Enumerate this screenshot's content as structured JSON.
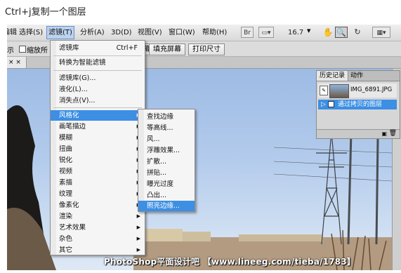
{
  "caption": "Ctrl+j复制一个图层",
  "menubar": {
    "items": [
      "编辑",
      "选择(S)",
      "滤镜(T)",
      "分析(A)",
      "3D(D)",
      "视图(V)",
      "窗口(W)",
      "帮助(H)"
    ],
    "zoom": "16.7"
  },
  "options": {
    "left_text": "示",
    "checkbox_label": "缩放所",
    "buttons": [
      "屏幕",
      "填充屏幕",
      "打印尺寸"
    ]
  },
  "doc_tab": {
    "label": "× ×"
  },
  "filter_menu": {
    "items": [
      {
        "label": "滤镜库",
        "shortcut": "Ctrl+F"
      },
      {
        "label": "转换为智能滤镜"
      },
      {
        "label": "滤镜库(G)..."
      },
      {
        "label": "液化(L)..."
      },
      {
        "label": "消失点(V)..."
      },
      {
        "label": "风格化"
      },
      {
        "label": "画笔描边"
      },
      {
        "label": "模糊"
      },
      {
        "label": "扭曲"
      },
      {
        "label": "锐化"
      },
      {
        "label": "视频"
      },
      {
        "label": "素描"
      },
      {
        "label": "纹理"
      },
      {
        "label": "像素化"
      },
      {
        "label": "渲染"
      },
      {
        "label": "艺术效果"
      },
      {
        "label": "杂色"
      },
      {
        "label": "其它"
      }
    ]
  },
  "stylize_submenu": {
    "items": [
      "查找边缘",
      "等高线...",
      "风...",
      "浮雕效果...",
      "扩散...",
      "拼贴...",
      "曝光过度",
      "凸出...",
      "照亮边缘..."
    ]
  },
  "history_panel": {
    "tabs": [
      "历史记录",
      "动作"
    ],
    "snapshot_name": "IMG_6891.JPG",
    "state_label": "通过拷贝的图层"
  },
  "watermark": "PhotoShop平面设计吧 【www.lineeg.com/tieba/1783】",
  "colors": {
    "highlight": "#3c8fe3",
    "sky": "#b3cbec"
  }
}
